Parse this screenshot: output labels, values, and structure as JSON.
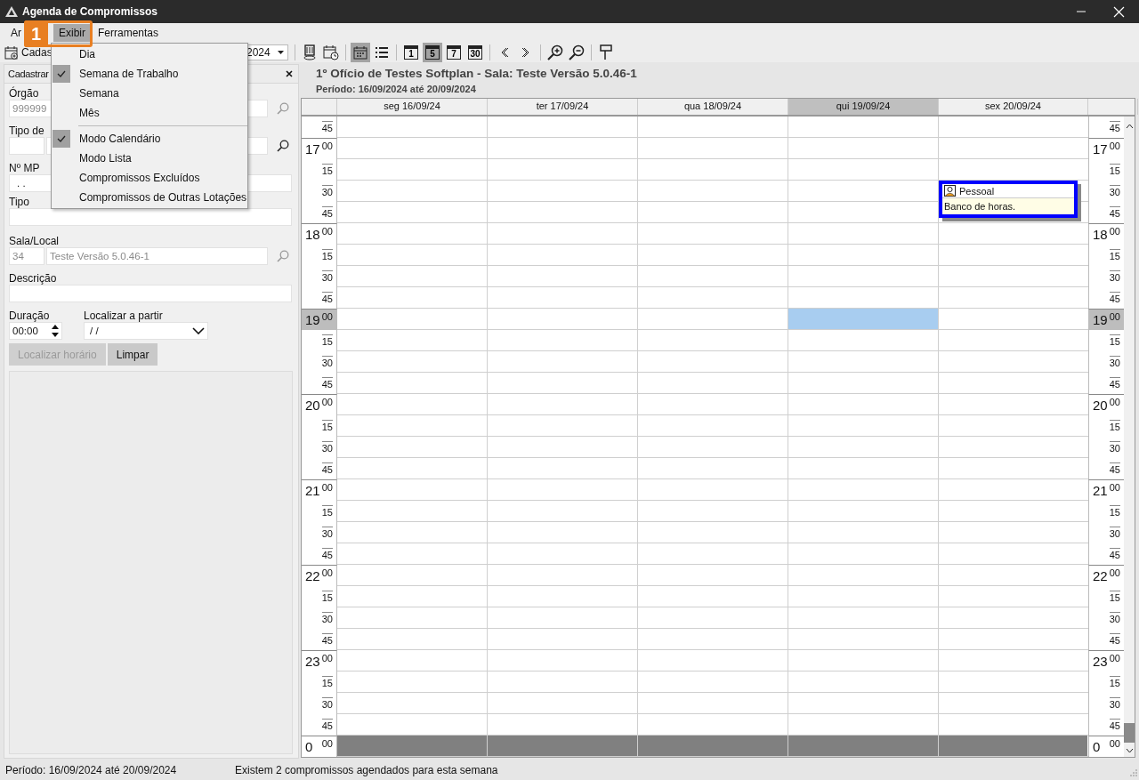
{
  "window": {
    "title": "Agenda de Compromissos"
  },
  "menu_bar": [
    {
      "label": "Ar",
      "selected": false
    },
    {
      "label": "Exibir",
      "selected": true
    },
    {
      "label": "Ferramentas",
      "selected": false
    }
  ],
  "callout": {
    "number": "1"
  },
  "dropdown": {
    "groups": [
      {
        "items": [
          {
            "label": "Dia",
            "checked": false
          },
          {
            "label": "Semana de Trabalho",
            "checked": true
          },
          {
            "label": "Semana",
            "checked": false
          },
          {
            "label": "Mês",
            "checked": false
          }
        ]
      },
      {
        "items": [
          {
            "label": "Modo Calendário",
            "checked": true
          },
          {
            "label": "Modo Lista",
            "checked": false
          },
          {
            "label": "Compromissos Excluídos",
            "checked": false
          },
          {
            "label": "Compromissos de Outras Lotações",
            "checked": false
          }
        ]
      }
    ]
  },
  "toolbar": {
    "new_label": "Cadas",
    "date_value": "2024"
  },
  "view_toolbar": [
    [
      {
        "selected": false
      },
      {
        "selected": false
      }
    ],
    [
      {
        "selected": true
      },
      {
        "selected": false
      }
    ],
    [
      {
        "label": "1",
        "selected": false
      },
      {
        "label": "5",
        "selected": true
      },
      {
        "label": "7",
        "selected": false
      },
      {
        "label": "30",
        "selected": false
      }
    ],
    [
      {
        "selected": false
      },
      {
        "selected": false
      }
    ],
    [
      {
        "selected": false
      },
      {
        "selected": false
      }
    ],
    [
      {
        "selected": false
      }
    ]
  ],
  "form": {
    "header": "Cadastrar",
    "orgao": {
      "label": "Órgão",
      "code": "999999",
      "disabled": true
    },
    "tipo_compromisso": {
      "label": "Tipo de"
    },
    "numero_mp": {
      "label": "Nº MP",
      "value": ".  ."
    },
    "tipo": {
      "label": "Tipo"
    },
    "sala": {
      "label": "Sala/Local",
      "code": "34",
      "name": "Teste Versão 5.0.46-1",
      "disabled": true
    },
    "descricao": {
      "label": "Descrição"
    },
    "duracao": {
      "label": "Duração",
      "value": "00:00"
    },
    "localizar": {
      "label": "Localizar a partir",
      "value": "/ /"
    },
    "buttons": [
      {
        "label": "Localizar horário",
        "disabled": true
      },
      {
        "label": "Limpar",
        "disabled": false
      }
    ]
  },
  "calendar": {
    "title": "1º Ofício de Testes Softplan - Sala: Teste Versão 5.0.46-1",
    "period": "Período: 16/09/2024 até 20/09/2024",
    "days": [
      {
        "label": "seg 16/09/24",
        "selected": false
      },
      {
        "label": "ter 17/09/24",
        "selected": false
      },
      {
        "label": "qua 18/09/24",
        "selected": false
      },
      {
        "label": "qui 19/09/24",
        "selected": true
      },
      {
        "label": "sex 20/09/24",
        "selected": false,
        "events": [
          {
            "title": "Pessoal",
            "text": "Banco de horas."
          }
        ]
      }
    ],
    "slots": [
      {
        "left": {
          "minute": "45"
        },
        "right": {
          "minute": "45"
        },
        "current": false,
        "closed": false
      },
      {
        "left": {
          "hour": "17",
          "minute": "00"
        },
        "right": {
          "hour": "17",
          "minute": "00"
        },
        "current": false,
        "closed": false
      },
      {
        "left": {
          "minute": "15"
        },
        "right": {
          "minute": "15"
        },
        "current": false,
        "closed": false
      },
      {
        "left": {
          "minute": "30"
        },
        "right": {
          "minute": "30"
        },
        "current": false,
        "closed": false,
        "event_start": true
      },
      {
        "left": {
          "minute": "45"
        },
        "right": {
          "minute": "45"
        },
        "current": false,
        "closed": false
      },
      {
        "left": {
          "hour": "18",
          "minute": "00"
        },
        "right": {
          "hour": "18",
          "minute": "00"
        },
        "current": false,
        "closed": false
      },
      {
        "left": {
          "minute": "15"
        },
        "right": {
          "minute": "15"
        },
        "current": false,
        "closed": false
      },
      {
        "left": {
          "minute": "30"
        },
        "right": {
          "minute": "30"
        },
        "current": false,
        "closed": false
      },
      {
        "left": {
          "minute": "45"
        },
        "right": {
          "minute": "45"
        },
        "current": false,
        "closed": false
      },
      {
        "left": {
          "hour": "19",
          "minute": "00"
        },
        "right": {
          "hour": "19",
          "minute": "00"
        },
        "current": true,
        "closed": false
      },
      {
        "left": {
          "minute": "15"
        },
        "right": {
          "minute": "15"
        },
        "current": false,
        "closed": false
      },
      {
        "left": {
          "minute": "30"
        },
        "right": {
          "minute": "30"
        },
        "current": false,
        "closed": false
      },
      {
        "left": {
          "minute": "45"
        },
        "right": {
          "minute": "45"
        },
        "current": false,
        "closed": false
      },
      {
        "left": {
          "hour": "20",
          "minute": "00"
        },
        "right": {
          "hour": "20",
          "minute": "00"
        },
        "current": false,
        "closed": false
      },
      {
        "left": {
          "minute": "15"
        },
        "right": {
          "minute": "15"
        },
        "current": false,
        "closed": false
      },
      {
        "left": {
          "minute": "30"
        },
        "right": {
          "minute": "30"
        },
        "current": false,
        "closed": false
      },
      {
        "left": {
          "minute": "45"
        },
        "right": {
          "minute": "45"
        },
        "current": false,
        "closed": false
      },
      {
        "left": {
          "hour": "21",
          "minute": "00"
        },
        "right": {
          "hour": "21",
          "minute": "00"
        },
        "current": false,
        "closed": false
      },
      {
        "left": {
          "minute": "15"
        },
        "right": {
          "minute": "15"
        },
        "current": false,
        "closed": false
      },
      {
        "left": {
          "minute": "30"
        },
        "right": {
          "minute": "30"
        },
        "current": false,
        "closed": false
      },
      {
        "left": {
          "minute": "45"
        },
        "right": {
          "minute": "45"
        },
        "current": false,
        "closed": false
      },
      {
        "left": {
          "hour": "22",
          "minute": "00"
        },
        "right": {
          "hour": "22",
          "minute": "00"
        },
        "current": false,
        "closed": false
      },
      {
        "left": {
          "minute": "15"
        },
        "right": {
          "minute": "15"
        },
        "current": false,
        "closed": false
      },
      {
        "left": {
          "minute": "30"
        },
        "right": {
          "minute": "30"
        },
        "current": false,
        "closed": false
      },
      {
        "left": {
          "minute": "45"
        },
        "right": {
          "minute": "45"
        },
        "current": false,
        "closed": false
      },
      {
        "left": {
          "hour": "23",
          "minute": "00"
        },
        "right": {
          "hour": "23",
          "minute": "00"
        },
        "current": false,
        "closed": false
      },
      {
        "left": {
          "minute": "15"
        },
        "right": {
          "minute": "15"
        },
        "current": false,
        "closed": false
      },
      {
        "left": {
          "minute": "30"
        },
        "right": {
          "minute": "30"
        },
        "current": false,
        "closed": false
      },
      {
        "left": {
          "minute": "45"
        },
        "right": {
          "minute": "45"
        },
        "current": false,
        "closed": false
      },
      {
        "left": {
          "hour": "0",
          "minute": "00"
        },
        "right": {
          "hour": "0",
          "minute": "00"
        },
        "current": false,
        "closed": true
      }
    ]
  },
  "status_bar": {
    "period": "Período: 16/09/2024 até 20/09/2024",
    "message": "Existem 2 compromissos agendados para esta semana"
  }
}
